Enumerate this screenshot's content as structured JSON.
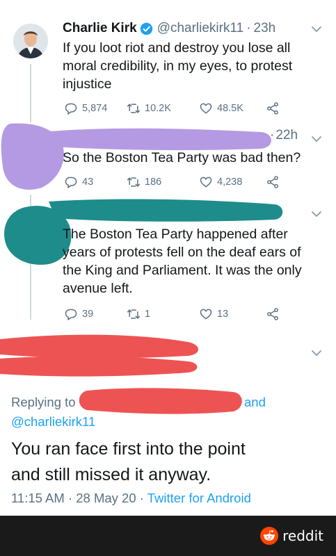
{
  "colors": {
    "link_blue": "#1da1f2",
    "muted_gray": "#5b7083",
    "redact_purple": "#b49ae3",
    "redact_teal": "#1e8c8a",
    "redact_red": "#ee5353",
    "verified_blue": "#1da1f2",
    "footer_bg": "#1a1a1b",
    "reddit_orange": "#ff4500"
  },
  "tweet1": {
    "display_name": "Charlie Kirk",
    "handle": "@charliekirk11",
    "separator": "·",
    "time": "23h",
    "text_line1": "If you loot riot and destroy you lose all",
    "text_line2": "moral credibility, in my eyes, to protest",
    "text_line3": "injustice",
    "replies": "5,874",
    "retweets": "10.2K",
    "likes": "48.5K",
    "icons": [
      "verified-icon",
      "chevron-down-icon",
      "reply-icon",
      "retweet-icon",
      "like-icon",
      "share-icon"
    ]
  },
  "tweet2": {
    "time_prefix": "·",
    "time": "22h",
    "text": "So the Boston Tea Party was bad then?",
    "replies": "43",
    "retweets": "186",
    "likes": "4,238"
  },
  "tweet3": {
    "text_line1": "The Boston Tea Party happened after",
    "text_line2": "years of protests fell on the deaf ears of",
    "text_line3": "the King and Parliament. It was the only",
    "text_line4": "avenue left.",
    "replies": "39",
    "retweets": "1",
    "likes": "13"
  },
  "main_tweet": {
    "replying_label": "Replying to",
    "and_text": "and",
    "replying_handle": "@charliekirk11",
    "text_line1": "You ran face first into the point",
    "text_line2": "and still missed it anyway.",
    "time": "11:15 AM",
    "dot": "·",
    "date": "28 May 20",
    "dot2": "·",
    "source": "Twitter for Android"
  },
  "footer": {
    "brand": "reddit",
    "icon": "reddit-snoo-icon"
  }
}
